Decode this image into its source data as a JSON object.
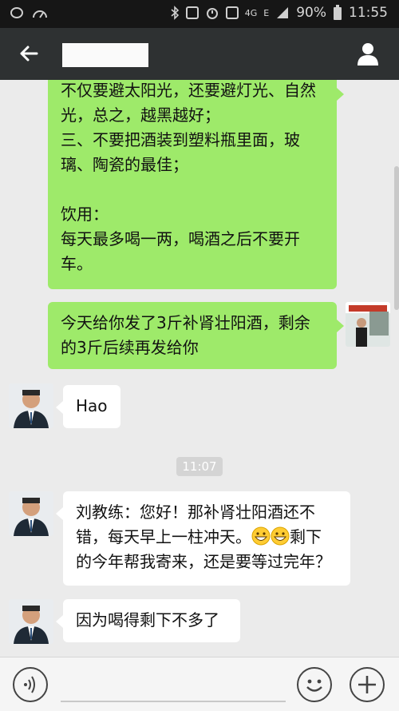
{
  "status_bar": {
    "network": "4G",
    "signal_label": "E",
    "battery": "90%",
    "time": "11:55"
  },
  "header": {
    "title": "",
    "back_icon": "arrow-left-icon",
    "profile_icon": "person-icon"
  },
  "messages": [
    {
      "side": "right",
      "text": "不仅要避太阳光，还要避灯光、自然\n光，总之，越黑越好；\n三、不要把酒装到塑料瓶里面，玻\n璃、陶瓷的最佳；\n\n饮用：\n每天最多喝一两，喝酒之后不要开\n车。"
    },
    {
      "side": "right",
      "text": "今天给你发了3斤补肾壮阳酒，剩余\n的3斤后续再发给你"
    },
    {
      "side": "left",
      "text": "Hao"
    },
    {
      "type": "time",
      "text": "11:07"
    },
    {
      "side": "left",
      "parts": [
        "刘教练：您好！那补肾壮阳酒还不\n错，每天早上一柱冲天。",
        "剩下\n的今年帮我寄来，还是要等过完年？"
      ],
      "emoji_icon": "grinning-face-icon"
    },
    {
      "side": "left",
      "text": "因为喝得剩下不多了"
    }
  ],
  "input_bar": {
    "voice_icon": "voice-icon",
    "emoji_icon": "smiley-icon",
    "plus_icon": "plus-icon"
  },
  "colors": {
    "status_bg": "#161616",
    "header_bg": "#2e3132",
    "chat_bg": "#ebebeb",
    "sent_bubble": "#9eea6a",
    "received_bubble": "#ffffff"
  }
}
